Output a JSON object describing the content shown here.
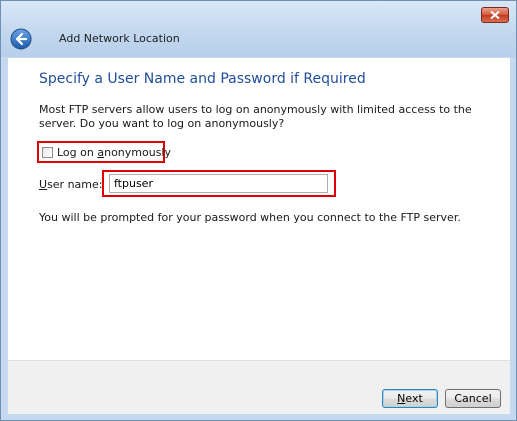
{
  "window": {
    "title": "Add Network Location",
    "close_icon": "close-icon",
    "back_icon": "back-arrow-icon"
  },
  "page": {
    "heading": "Specify a User Name and Password if Required",
    "description": "Most FTP servers allow users to log on anonymously with limited access to the server.  Do you want to log on anonymously?",
    "anonymous_checkbox": {
      "label": "Log on anonymously",
      "checked": false
    },
    "username": {
      "label": "User name:",
      "value": "ftpuser"
    },
    "note": "You will be prompted for your password when you connect to the FTP server."
  },
  "footer": {
    "next_label": "Next",
    "cancel_label": "Cancel"
  },
  "colors": {
    "heading": "#1f4e9a",
    "highlight_box": "#e00000",
    "titlebar": "#c5d8ee",
    "close_button": "#c23a1c"
  }
}
